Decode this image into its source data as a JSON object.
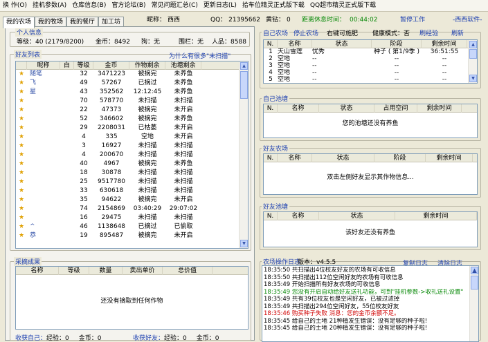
{
  "menu": [
    "换 作(O)",
    "挂机参数(A)",
    "仓库信息(B)",
    "官方论坛(B)",
    "常见问题汇总(C)",
    "更新日志(L)",
    "拾车位精灵正式版下载",
    "QQ超市精灵正式版下载"
  ],
  "tabs": [
    "我的农场",
    "我的牧场",
    "我的餐厅",
    "加工坊"
  ],
  "status": {
    "nick_label": "昵称：",
    "nick": "西西",
    "qq_label": "QQ：",
    "qq": "21395662",
    "coupon_label": "黄钻：",
    "coupon": "0",
    "rest_label": "距离休息时间：",
    "rest": "00:44:02",
    "pause": "暂停工作",
    "soft": "-西西软件-"
  },
  "personal": {
    "title": "个人信息",
    "level_label": "等级：",
    "level": "40 (2179/8200)",
    "gold_label": "金币：",
    "gold": "8492",
    "dog_label": "狗：",
    "dog": "无",
    "ward_label": "围栏：",
    "ward": "无",
    "pop_label": "人品：",
    "pop": "8588"
  },
  "friends": {
    "title": "好友列表",
    "why": "为什么有很多\"未扫描\"",
    "headers": [
      "昵称",
      "白",
      "等级",
      "金币",
      "作物剩余",
      "池塘剩余"
    ],
    "rows": [
      [
        "随笔",
        "",
        "32",
        "3471223",
        "被摘完",
        "未养鱼"
      ],
      [
        "飞",
        "",
        "49",
        "57267",
        "已摘过",
        "未养鱼"
      ],
      [
        "星",
        "",
        "43",
        "352562",
        "12:12:45",
        "未养鱼"
      ],
      [
        "",
        "",
        "70",
        "578770",
        "未扫描",
        "未扫描"
      ],
      [
        "",
        "",
        "22",
        "47373",
        "被摘完",
        "未开启"
      ],
      [
        "",
        "",
        "52",
        "346602",
        "被摘完",
        "未养鱼"
      ],
      [
        "",
        "",
        "29",
        "2208031",
        "已枯萎",
        "未开启"
      ],
      [
        "",
        "",
        "4",
        "335",
        "空地",
        "未开启"
      ],
      [
        "",
        "",
        "3",
        "16927",
        "未扫描",
        "未扫描"
      ],
      [
        "",
        "",
        "4",
        "200670",
        "未扫描",
        "未扫描"
      ],
      [
        "",
        "",
        "40",
        "4967",
        "被摘完",
        "未养鱼"
      ],
      [
        "",
        "",
        "18",
        "30878",
        "未扫描",
        "未扫描"
      ],
      [
        "",
        "",
        "25",
        "9517780",
        "未扫描",
        "未扫描"
      ],
      [
        "",
        "",
        "33",
        "630618",
        "未扫描",
        "未扫描"
      ],
      [
        "",
        "",
        "35",
        "94622",
        "被摘完",
        "未开启"
      ],
      [
        "",
        "",
        "74",
        "2154869",
        "03:40:29",
        "29:07:02"
      ],
      [
        "",
        "",
        "16",
        "29475",
        "未扫描",
        "未扫描"
      ],
      [
        "^",
        "",
        "46",
        "1138648",
        "已摘过",
        "已偷取"
      ],
      [
        "恭",
        "",
        "19",
        "895487",
        "被摘完",
        "未开启"
      ]
    ]
  },
  "harvest": {
    "title": "采摘成果",
    "headers": [
      "名称",
      "等级",
      "数量",
      "卖出单价",
      "总价值"
    ],
    "empty": "还没有摘取到任何作物",
    "footer_self": "收获自己：",
    "exp_label": "经验：",
    "exp_self": "0",
    "gold_label": "金币：",
    "gold_self": "0",
    "footer_friend": "收获好友：",
    "exp_friend": "0",
    "gold_friend": "0"
  },
  "my_farm": {
    "title": "自己农场",
    "stop": "停止农场",
    "right_hint": "右键可施肥",
    "health": "健康模式：否",
    "refresh_exp": "刷经验",
    "refresh": "刷新",
    "headers": [
      "N.",
      "名称",
      "状态",
      "阶段",
      "剩余时间"
    ],
    "rows": [
      [
        "1",
        "天山雪莲",
        "忧秀",
        "种子 ( 第1/9季 )",
        "36:51:55"
      ],
      [
        "2",
        "空地",
        "--",
        "--",
        "--"
      ],
      [
        "3",
        "空地",
        "--",
        "--",
        "--"
      ],
      [
        "4",
        "空地",
        "--",
        "--",
        "--"
      ],
      [
        "5",
        "空地",
        "--",
        "--",
        "--"
      ]
    ]
  },
  "my_pond": {
    "title": "自己池塘",
    "headers": [
      "N.",
      "名称",
      "状态",
      "占用空间",
      "剩余时间"
    ],
    "empty": "您的池塘还没有养鱼"
  },
  "friend_farm": {
    "title": "好友农场",
    "headers": [
      "N.",
      "名称",
      "状态",
      "阶段",
      "剩余时间"
    ],
    "empty": "双击左侧好友显示其作物信息..."
  },
  "friend_pond": {
    "title": "好友池塘",
    "headers": [
      "N.",
      "名称",
      "状态",
      "剩余时间"
    ],
    "empty": "该好友还没有养鱼"
  },
  "log": {
    "title": "农场操作日志",
    "version_label": "版本：",
    "version": "v4.5.5",
    "copy": "复制日志",
    "clear": "清除日志",
    "lines": [
      {
        "t": "18:35:50 共扫描出4位校友好友的农场有可收信息",
        "c": "#000000"
      },
      {
        "t": "18:35:50 共扫描出112位空闲好友的农场有可收信息",
        "c": "#000000"
      },
      {
        "t": "18:35:49 开始扫描所有好友农场的可收信息",
        "c": "#000000"
      },
      {
        "t": "18:35:49 您没有开启自动给好友送礼功能，可到\"挂机参数->收礼送礼设置\"",
        "c": "#0a8a0a"
      },
      {
        "t": "18:35:49 共有39位校友也是空闲好友，已被过滤掉",
        "c": "#000000"
      },
      {
        "t": "18:35:49 共扫描出294位空闲好友，55位校友好友",
        "c": "#000000"
      },
      {
        "t": "18:35:46 购买种子失败 消息：您的金币余额不足。",
        "c": "#d00000"
      },
      {
        "t": "18:35:45 给自己的土地 21种植发生错误：没有足够的种子啦!",
        "c": "#000000"
      },
      {
        "t": "18:35:45 给自己的土地 20种植发生错误：没有足够的种子啦!",
        "c": "#000000"
      }
    ]
  },
  "colors": {
    "accent": "#1c3fb0",
    "green": "#0a8a0a",
    "red": "#d00000",
    "bg": "#ece9d8"
  }
}
